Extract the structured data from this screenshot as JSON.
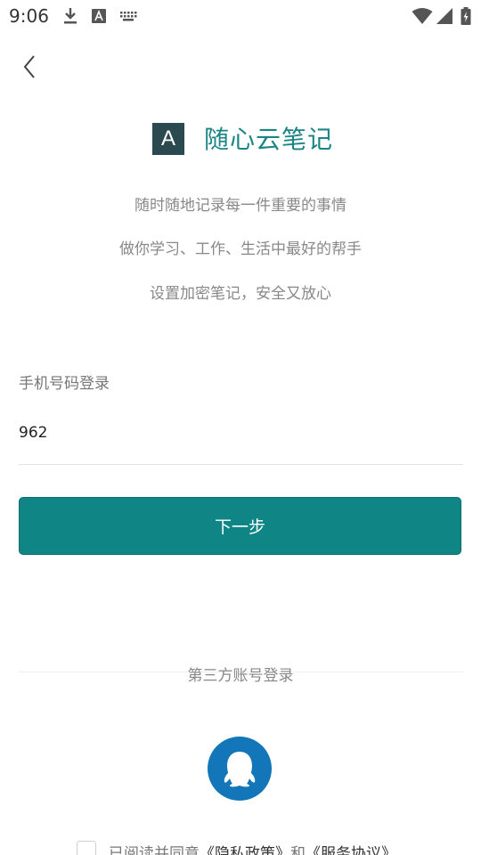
{
  "status_bar": {
    "time": "9:06",
    "icons": [
      "download-icon",
      "text-a-icon",
      "keyboard-icon",
      "wifi-icon",
      "signal-icon",
      "battery-charging-icon"
    ]
  },
  "nav": {
    "back_icon": "chevron-left-icon"
  },
  "brand": {
    "logo_letter": "A",
    "name": "随心云笔记",
    "logo_color": "#2a4a4f",
    "name_color": "#1b8585"
  },
  "taglines": [
    "随时随地记录每一件重要的事情",
    "做你学习、工作、生活中最好的帮手",
    "设置加密笔记，安全又放心"
  ],
  "login": {
    "label": "手机号码登录",
    "phone_value": "962",
    "next_label": "下一步",
    "button_color": "#108585"
  },
  "third_party": {
    "title": "第三方账号登录",
    "qq_icon": "qq-penguin-icon",
    "qq_color": "#1276b8"
  },
  "agreement": {
    "prefix": "已阅读并同意",
    "privacy_link": "《隐私政策》",
    "and": "和",
    "service_link": "《服务协议》"
  }
}
